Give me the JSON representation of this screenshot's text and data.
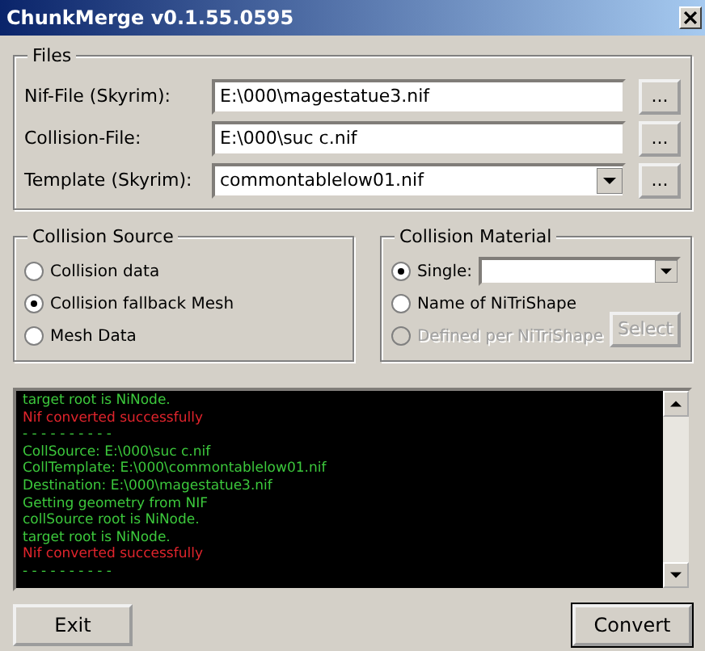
{
  "window": {
    "title": "ChunkMerge  v0.1.55.0595"
  },
  "files": {
    "title": "Files",
    "rows": [
      {
        "label": "Nif-File (Skyrim):",
        "kind": "text",
        "value": "E:\\000\\magestatue3.nif",
        "browse": "..."
      },
      {
        "label": "Collision-File:",
        "kind": "text",
        "value": "E:\\000\\suc c.nif",
        "browse": "..."
      },
      {
        "label": "Template (Skyrim):",
        "kind": "combo",
        "value": "commontablelow01.nif",
        "browse": "..."
      }
    ]
  },
  "collision_source": {
    "title": "Collision Source",
    "options": [
      {
        "label": "Collision data",
        "selected": false
      },
      {
        "label": "Collision fallback Mesh",
        "selected": true
      },
      {
        "label": "Mesh Data",
        "selected": false
      }
    ]
  },
  "collision_material": {
    "title": "Collision Material",
    "options": [
      {
        "label": "Single:",
        "selected": true,
        "disabled": false,
        "kind": "combo"
      },
      {
        "label": "Name of NiTriShape",
        "selected": false,
        "disabled": false,
        "kind": "plain"
      },
      {
        "label": "Defined per NiTriShape",
        "selected": false,
        "disabled": true,
        "kind": "plain"
      }
    ],
    "select_button": {
      "label": "Select",
      "disabled": true
    }
  },
  "log": [
    {
      "text": "target root is NiNode.",
      "kind": "info"
    },
    {
      "text": "Nif converted successfully",
      "kind": "success"
    },
    {
      "text": "- - - - - - - - - -",
      "kind": "info"
    },
    {
      "text": "CollSource:  E:\\000\\suc c.nif",
      "kind": "info"
    },
    {
      "text": "CollTemplate:  E:\\000\\commontablelow01.nif",
      "kind": "info"
    },
    {
      "text": "Destination:  E:\\000\\magestatue3.nif",
      "kind": "info"
    },
    {
      "text": "Getting geometry from NIF",
      "kind": "info"
    },
    {
      "text": "collSource root is NiNode.",
      "kind": "info"
    },
    {
      "text": "target root is NiNode.",
      "kind": "info"
    },
    {
      "text": "Nif converted successfully",
      "kind": "success"
    },
    {
      "text": "- - - - - - - - - -",
      "kind": "info"
    }
  ],
  "buttons": [
    {
      "label": "Exit",
      "default": false
    },
    {
      "label": "Convert",
      "default": true
    }
  ]
}
